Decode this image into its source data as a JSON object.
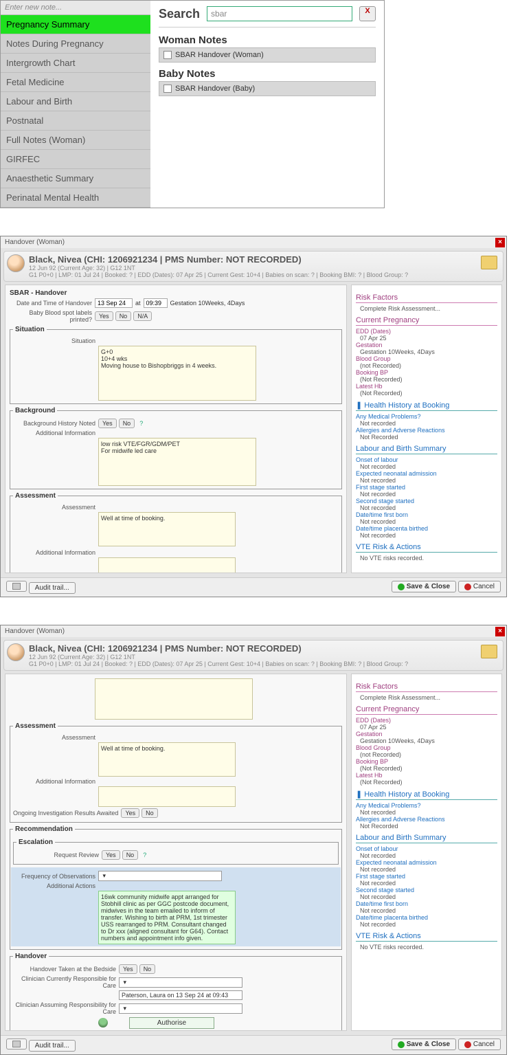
{
  "shot1": {
    "enter_note": "Enter new note...",
    "sidebar": [
      "Pregnancy Summary",
      "Notes During Pregnancy",
      "Intergrowth Chart",
      "Fetal Medicine",
      "Labour and Birth",
      "Postnatal",
      "Full Notes (Woman)",
      "GIRFEC",
      "Anaesthetic Summary",
      "Perinatal Mental Health"
    ],
    "search_label": "Search",
    "search_value": "sbar",
    "woman_notes": "Woman Notes",
    "woman_result": "SBAR Handover (Woman)",
    "baby_notes": "Baby Notes",
    "baby_result": "SBAR Handover (Baby)"
  },
  "shot2": {
    "window_title": "Handover (Woman)",
    "patient_name": "Black, Nivea (CHI: 1206921234 | PMS Number: NOT RECORDED)",
    "patient_line1": "12 Jun 92 (Current Age: 32) | G12 1NT",
    "patient_line2": "G1 P0+0 | LMP: 01 Jul 24 | Booked: ? | EDD (Dates): 07 Apr 25 | Current Gest: 10+4 | Babies on scan: ? | Booking BMI: ? | Blood Group: ?",
    "sbar_title": "SBAR - Handover",
    "dt_label": "Date and Time of Handover",
    "dt_date": "13 Sep 24",
    "dt_at": "at",
    "dt_time": "09:39",
    "gestation": "Gestation 10Weeks, 4Days",
    "blood_label": "Baby Blood spot labels printed?",
    "yes": "Yes",
    "no": "No",
    "na": "N/A",
    "situation_legend": "Situation",
    "situation_label": "Situation",
    "situation_text": "G+0\n10+4 wks\nMoving house to Bishopbriggs in 4 weeks.",
    "background_legend": "Background",
    "bg_noted_label": "Background History Noted",
    "addl_info_label": "Additional Information",
    "bg_text": "low risk VTE/FGR/GDM/PET\nFor midwife led care",
    "assessment_legend": "Assessment",
    "assessment_label": "Assessment",
    "assessment_text": "Well at time of booking.",
    "ongoing_label": "Ongoing Investigation Results Awaited",
    "info": {
      "risk_head": "Risk Factors",
      "risk_complete": "Complete Risk Assessment...",
      "cp_head": "Current Pregnancy",
      "edd_l": "EDD (Dates)",
      "edd_v": "07 Apr 25",
      "gest_l": "Gestation",
      "gest_v": "Gestation 10Weeks, 4Days",
      "bg_l": "Blood Group",
      "bg_v": "(not Recorded)",
      "bp_l": "Booking BP",
      "bp_v": "(Not Recorded)",
      "hb_l": "Latest Hb",
      "hb_v": "(Not Recorded)",
      "hh_head": "Health History at Booking",
      "med_l": "Any Medical Problems?",
      "med_v": "Not recorded",
      "allerg_l": "Allergies and Adverse Reactions",
      "allerg_v": "Not Recorded",
      "lb_head": "Labour and Birth Summary",
      "onset_l": "Onset of labour",
      "nr": "Not recorded",
      "neonatal_l": "Expected neonatal admission",
      "first_l": "First stage started",
      "second_l": "Second stage started",
      "dtborn_l": "Date/time first born",
      "dtplac_l": "Date/time placenta birthed",
      "vte_head": "VTE Risk & Actions",
      "vte_v": "No VTE risks recorded."
    },
    "audit": "Audit trail...",
    "save": "Save & Close",
    "cancel": "Cancel"
  },
  "shot3": {
    "recommendation_legend": "Recommendation",
    "escalation_legend": "Escalation",
    "request_review_label": "Request Review",
    "freq_label": "Frequency of Observations",
    "actions_label": "Additional Actions",
    "actions_text": "16wk community midwife appt arranged for Stobhill clinic as per GGC postcode document, midwives in the team emailed to inform of transfer. Wishing to birth at PRM, 1st trimester USS rearranged to PRM. Consultant changed to Dr xxx (aligned consultant for G64). Contact numbers and appointment info given.",
    "handover_legend": "Handover",
    "ho_bedside_label": "Handover Taken at the Bedside",
    "clin_resp_label": "Clinician Currently Responsible for Care",
    "clin_assume_label": "Clinician Assuming Responsibility for Care",
    "clin_value": "Paterson, Laura on 13 Sep 24 at 09:43",
    "authorise": "Authorise"
  }
}
